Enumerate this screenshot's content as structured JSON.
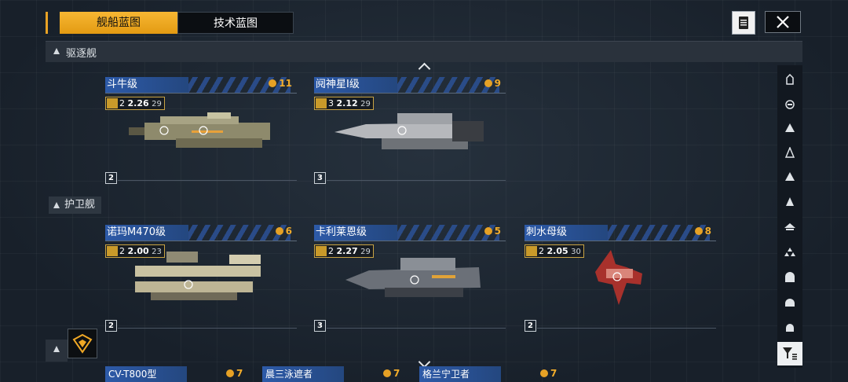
{
  "tabs": {
    "ship_blueprint": "舰船蓝图",
    "tech_blueprint": "技术蓝图"
  },
  "section": {
    "current": "驱逐舰"
  },
  "categories": {
    "escort": "护卫舰"
  },
  "ships_row1": [
    {
      "name": "斗牛级",
      "cost": "11",
      "stat_a": "2",
      "stat_main": "2.26",
      "stat_sub": "29",
      "tier": "2"
    },
    {
      "name": "阋神星I级",
      "cost": "9",
      "stat_a": "3",
      "stat_main": "2.12",
      "stat_sub": "29",
      "tier": "3"
    }
  ],
  "ships_row2": [
    {
      "name": "诺玛M470级",
      "cost": "6",
      "stat_a": "2",
      "stat_main": "2.00",
      "stat_sub": "23",
      "tier": "2"
    },
    {
      "name": "卡利莱恩级",
      "cost": "5",
      "stat_a": "2",
      "stat_main": "2.27",
      "stat_sub": "29",
      "tier": "3"
    },
    {
      "name": "刺水母级",
      "cost": "8",
      "stat_a": "2",
      "stat_main": "2.05",
      "stat_sub": "30",
      "tier": "2"
    }
  ],
  "ships_row3_partial": [
    {
      "name": "CV-T800型",
      "cost": "7"
    },
    {
      "name": "晨三泳遮者",
      "cost": "7"
    },
    {
      "name": "格兰宁卫者",
      "cost": "7"
    }
  ],
  "sidebar_icons": [
    "category-all-icon",
    "carrier-icon",
    "cruiser-icon",
    "destroyer-icon",
    "frigate-icon",
    "corvette-icon",
    "aircraft-icon",
    "fleet-icon",
    "hangar-icon",
    "support-icon",
    "other-icon"
  ],
  "colors": {
    "accent": "#f0a825",
    "title_blue": "#2d5aa8",
    "cost_orange": "#f1ac2b"
  }
}
